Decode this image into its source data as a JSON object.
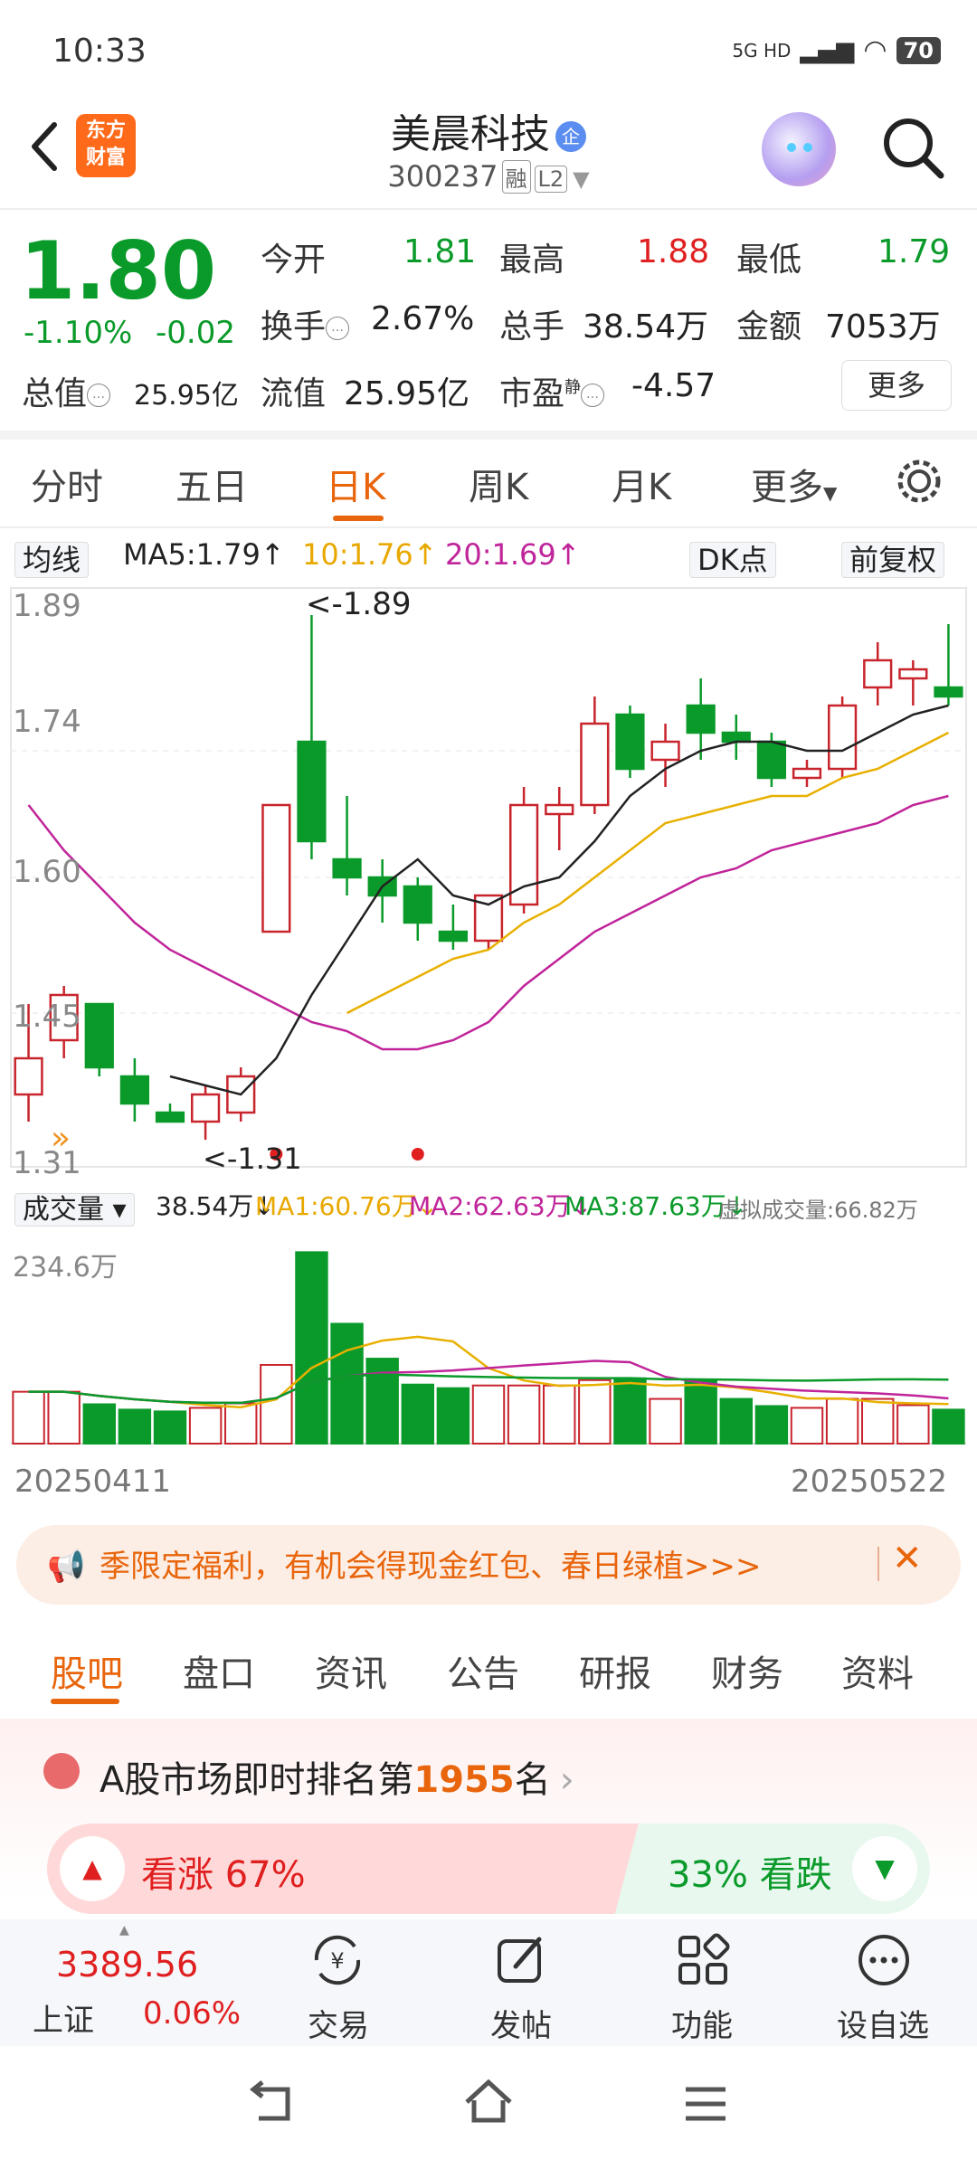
{
  "status": {
    "time": "10:33",
    "network": "5G HD",
    "battery": "70"
  },
  "header": {
    "logo_line1": "东方",
    "logo_line2": "财富",
    "stock_name": "美晨科技",
    "badge": "企",
    "code": "300237",
    "tag1": "融",
    "tag2": "L2"
  },
  "quote": {
    "price": "1.80",
    "change_pct": "-1.10%",
    "change": "-0.02",
    "open_label": "今开",
    "open": "1.81",
    "high_label": "最高",
    "high": "1.88",
    "low_label": "最低",
    "low": "1.79",
    "turnover_label": "换手",
    "turnover": "2.67%",
    "volume_label": "总手",
    "volume": "38.54万",
    "amount_label": "金额",
    "amount": "7053万",
    "mktcap_label": "总值",
    "mktcap": "25.95亿",
    "float_label": "流值",
    "float": "25.95亿",
    "pe_label": "市盈",
    "pe_sup": "静",
    "pe": "-4.57",
    "more": "更多"
  },
  "period_tabs": [
    "分时",
    "五日",
    "日K",
    "周K",
    "月K",
    "更多"
  ],
  "ma": {
    "selector": "均线",
    "ma5": "MA5:1.79",
    "ma10": "10:1.76",
    "ma20": "20:1.69",
    "dk": "DK点",
    "adjust": "前复权"
  },
  "chart_data": {
    "type": "candlestick",
    "y_ticks": [
      "1.89",
      "1.74",
      "1.60",
      "1.45",
      "1.31"
    ],
    "ylim": [
      1.31,
      1.89
    ],
    "annotations": [
      "<-1.89",
      "<-1.31"
    ],
    "x_labels": [
      "20250411",
      "20250522"
    ],
    "candles": [
      {
        "o": 1.36,
        "h": 1.46,
        "l": 1.33,
        "c": 1.4
      },
      {
        "o": 1.42,
        "h": 1.48,
        "l": 1.4,
        "c": 1.47
      },
      {
        "o": 1.46,
        "h": 1.46,
        "l": 1.38,
        "c": 1.39
      },
      {
        "o": 1.38,
        "h": 1.4,
        "l": 1.33,
        "c": 1.35
      },
      {
        "o": 1.34,
        "h": 1.35,
        "l": 1.33,
        "c": 1.33
      },
      {
        "o": 1.33,
        "h": 1.37,
        "l": 1.31,
        "c": 1.36
      },
      {
        "o": 1.34,
        "h": 1.39,
        "l": 1.33,
        "c": 1.38
      },
      {
        "o": 1.54,
        "h": 1.68,
        "l": 1.54,
        "c": 1.68
      },
      {
        "o": 1.75,
        "h": 1.89,
        "l": 1.62,
        "c": 1.64
      },
      {
        "o": 1.62,
        "h": 1.69,
        "l": 1.58,
        "c": 1.6
      },
      {
        "o": 1.6,
        "h": 1.62,
        "l": 1.55,
        "c": 1.58
      },
      {
        "o": 1.59,
        "h": 1.6,
        "l": 1.53,
        "c": 1.55
      },
      {
        "o": 1.54,
        "h": 1.57,
        "l": 1.52,
        "c": 1.53
      },
      {
        "o": 1.53,
        "h": 1.58,
        "l": 1.52,
        "c": 1.58
      },
      {
        "o": 1.57,
        "h": 1.7,
        "l": 1.56,
        "c": 1.68
      },
      {
        "o": 1.67,
        "h": 1.7,
        "l": 1.63,
        "c": 1.68
      },
      {
        "o": 1.68,
        "h": 1.8,
        "l": 1.67,
        "c": 1.77
      },
      {
        "o": 1.78,
        "h": 1.79,
        "l": 1.71,
        "c": 1.72
      },
      {
        "o": 1.73,
        "h": 1.77,
        "l": 1.7,
        "c": 1.75
      },
      {
        "o": 1.79,
        "h": 1.82,
        "l": 1.73,
        "c": 1.76
      },
      {
        "o": 1.76,
        "h": 1.78,
        "l": 1.73,
        "c": 1.75
      },
      {
        "o": 1.75,
        "h": 1.76,
        "l": 1.7,
        "c": 1.71
      },
      {
        "o": 1.71,
        "h": 1.73,
        "l": 1.7,
        "c": 1.72
      },
      {
        "o": 1.72,
        "h": 1.8,
        "l": 1.71,
        "c": 1.79
      },
      {
        "o": 1.81,
        "h": 1.86,
        "l": 1.79,
        "c": 1.84
      },
      {
        "o": 1.82,
        "h": 1.84,
        "l": 1.79,
        "c": 1.83
      },
      {
        "o": 1.81,
        "h": 1.88,
        "l": 1.79,
        "c": 1.8
      }
    ],
    "ma5": [
      null,
      null,
      null,
      null,
      1.38,
      1.37,
      1.36,
      1.4,
      1.47,
      1.53,
      1.59,
      1.62,
      1.58,
      1.57,
      1.59,
      1.6,
      1.64,
      1.69,
      1.72,
      1.74,
      1.75,
      1.75,
      1.74,
      1.74,
      1.76,
      1.78,
      1.79
    ],
    "ma10": [
      null,
      null,
      null,
      null,
      null,
      null,
      null,
      null,
      null,
      1.45,
      1.47,
      1.49,
      1.51,
      1.52,
      1.55,
      1.57,
      1.6,
      1.63,
      1.66,
      1.67,
      1.68,
      1.69,
      1.69,
      1.71,
      1.72,
      1.74,
      1.76
    ],
    "ma20": [
      1.68,
      1.63,
      1.59,
      1.55,
      1.52,
      1.5,
      1.48,
      1.46,
      1.44,
      1.43,
      1.41,
      1.41,
      1.42,
      1.44,
      1.48,
      1.51,
      1.54,
      1.56,
      1.58,
      1.6,
      1.61,
      1.63,
      1.64,
      1.65,
      1.66,
      1.68,
      1.69
    ],
    "volume": [
      58,
      58,
      44,
      38,
      36,
      40,
      45,
      88,
      214,
      134,
      95,
      66,
      62,
      65,
      65,
      65,
      71,
      73,
      50,
      70,
      50,
      42,
      40,
      50,
      50,
      43,
      38
    ],
    "vol_max_label": "234.6万"
  },
  "vol": {
    "selector": "成交量",
    "v": "38.54万",
    "ma1": "MA1:60.76万",
    "ma2": "MA2:62.63万",
    "ma3": "MA3:87.63万",
    "virtual": "虚拟成交量:66.82万"
  },
  "promo": {
    "text": "季限定福利，有机会得现金红包、春日绿植>>>"
  },
  "news_tabs": [
    "股吧",
    "盘口",
    "资讯",
    "公告",
    "研报",
    "财务",
    "资料"
  ],
  "rank": {
    "prefix": "A股市场即时排名第",
    "num": "1955",
    "suffix": "名"
  },
  "vote": {
    "up": "看涨 67%",
    "up_value": 0.67,
    "down": "33% 看跌"
  },
  "bottom": {
    "index_value": "3389.56",
    "index_name": "上证",
    "index_pct": "0.06%",
    "nav": [
      "交易",
      "发帖",
      "功能",
      "设自选"
    ]
  },
  "colors": {
    "up": "#e02020",
    "down": "#0a9a2a",
    "accent": "#e8650c"
  }
}
